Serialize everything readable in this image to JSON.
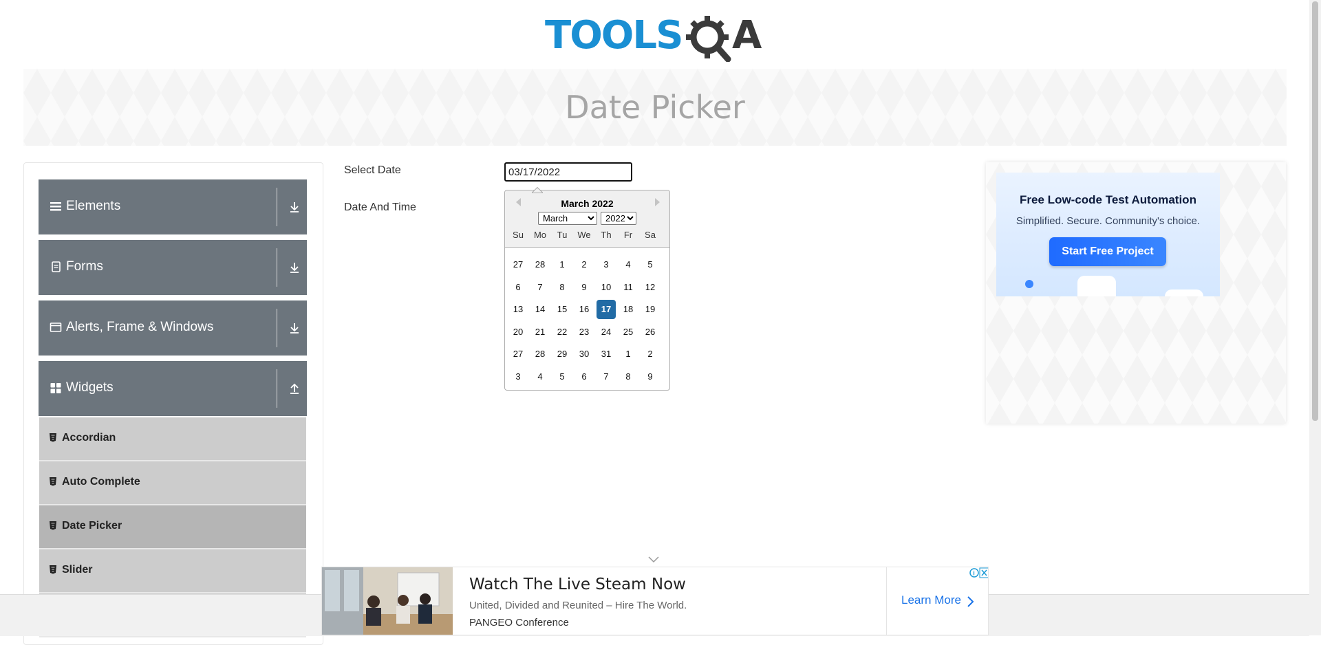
{
  "brand": {
    "logo_text": "TOOLSQA"
  },
  "page": {
    "title": "Date Picker"
  },
  "sidebar": {
    "groups": [
      {
        "label": "Elements",
        "icon": "hamburger-icon",
        "arrow": "expand-arrow-icon"
      },
      {
        "label": "Forms",
        "icon": "form-icon",
        "arrow": "expand-arrow-icon"
      },
      {
        "label": "Alerts, Frame & Windows",
        "icon": "window-icon",
        "arrow": "expand-arrow-icon"
      },
      {
        "label": "Widgets",
        "icon": "grid-icon",
        "arrow": "collapse-arrow-icon"
      }
    ],
    "widget_items": [
      {
        "label": "Accordian",
        "active": false
      },
      {
        "label": "Auto Complete",
        "active": false
      },
      {
        "label": "Date Picker",
        "active": true
      },
      {
        "label": "Slider",
        "active": false
      }
    ]
  },
  "form": {
    "select_date_label": "Select Date",
    "date_time_label": "Date And Time",
    "select_date_value": "03/17/2022"
  },
  "datepicker": {
    "title": "March 2022",
    "month_select": "March",
    "year_select": "2022",
    "weekdays": [
      "Su",
      "Mo",
      "Tu",
      "We",
      "Th",
      "Fr",
      "Sa"
    ],
    "weeks": [
      [
        "27",
        "28",
        "1",
        "2",
        "3",
        "4",
        "5"
      ],
      [
        "6",
        "7",
        "8",
        "9",
        "10",
        "11",
        "12"
      ],
      [
        "13",
        "14",
        "15",
        "16",
        "17",
        "18",
        "19"
      ],
      [
        "20",
        "21",
        "22",
        "23",
        "24",
        "25",
        "26"
      ],
      [
        "27",
        "28",
        "29",
        "30",
        "31",
        "1",
        "2"
      ],
      [
        "3",
        "4",
        "5",
        "6",
        "7",
        "8",
        "9"
      ]
    ],
    "selected_day": "17",
    "selected_color": "#216ba5"
  },
  "side_ad": {
    "title": "Free Low-code Test Automation",
    "subtitle": "Simplified. Secure. Community's choice.",
    "button": "Start Free Project"
  },
  "bottom_ad": {
    "headline": "Watch The Live Steam Now",
    "subtitle": "United, Divided and Reunited – Hire The World.",
    "brand": "PANGEO Conference",
    "cta": "Learn More"
  },
  "colors": {
    "sidebar_header": "#6c757d",
    "menu_item": "#cccccc",
    "menu_item_active": "#b5b5b5",
    "logo_blue": "#1a8fd3",
    "logo_dark": "#3b3b3b"
  }
}
